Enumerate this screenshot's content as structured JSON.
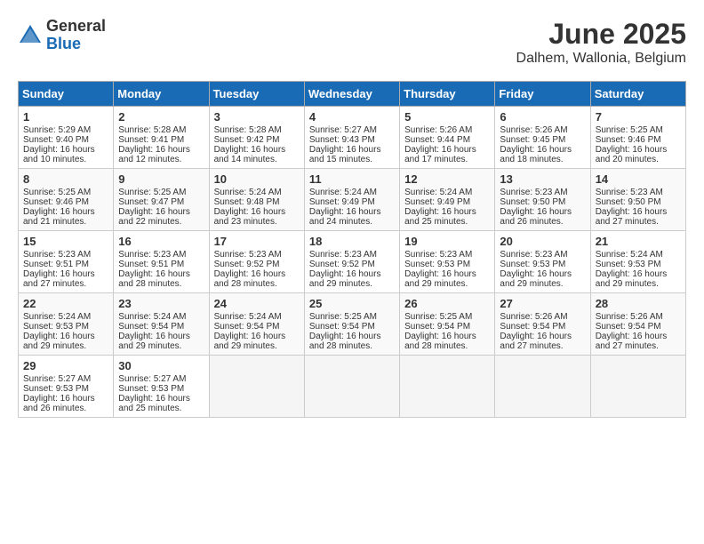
{
  "logo": {
    "general": "General",
    "blue": "Blue"
  },
  "title": "June 2025",
  "location": "Dalhem, Wallonia, Belgium",
  "headers": [
    "Sunday",
    "Monday",
    "Tuesday",
    "Wednesday",
    "Thursday",
    "Friday",
    "Saturday"
  ],
  "weeks": [
    [
      {
        "day": "1",
        "sunrise": "Sunrise: 5:29 AM",
        "sunset": "Sunset: 9:40 PM",
        "daylight": "Daylight: 16 hours and 10 minutes."
      },
      {
        "day": "2",
        "sunrise": "Sunrise: 5:28 AM",
        "sunset": "Sunset: 9:41 PM",
        "daylight": "Daylight: 16 hours and 12 minutes."
      },
      {
        "day": "3",
        "sunrise": "Sunrise: 5:28 AM",
        "sunset": "Sunset: 9:42 PM",
        "daylight": "Daylight: 16 hours and 14 minutes."
      },
      {
        "day": "4",
        "sunrise": "Sunrise: 5:27 AM",
        "sunset": "Sunset: 9:43 PM",
        "daylight": "Daylight: 16 hours and 15 minutes."
      },
      {
        "day": "5",
        "sunrise": "Sunrise: 5:26 AM",
        "sunset": "Sunset: 9:44 PM",
        "daylight": "Daylight: 16 hours and 17 minutes."
      },
      {
        "day": "6",
        "sunrise": "Sunrise: 5:26 AM",
        "sunset": "Sunset: 9:45 PM",
        "daylight": "Daylight: 16 hours and 18 minutes."
      },
      {
        "day": "7",
        "sunrise": "Sunrise: 5:25 AM",
        "sunset": "Sunset: 9:46 PM",
        "daylight": "Daylight: 16 hours and 20 minutes."
      }
    ],
    [
      {
        "day": "8",
        "sunrise": "Sunrise: 5:25 AM",
        "sunset": "Sunset: 9:46 PM",
        "daylight": "Daylight: 16 hours and 21 minutes."
      },
      {
        "day": "9",
        "sunrise": "Sunrise: 5:25 AM",
        "sunset": "Sunset: 9:47 PM",
        "daylight": "Daylight: 16 hours and 22 minutes."
      },
      {
        "day": "10",
        "sunrise": "Sunrise: 5:24 AM",
        "sunset": "Sunset: 9:48 PM",
        "daylight": "Daylight: 16 hours and 23 minutes."
      },
      {
        "day": "11",
        "sunrise": "Sunrise: 5:24 AM",
        "sunset": "Sunset: 9:49 PM",
        "daylight": "Daylight: 16 hours and 24 minutes."
      },
      {
        "day": "12",
        "sunrise": "Sunrise: 5:24 AM",
        "sunset": "Sunset: 9:49 PM",
        "daylight": "Daylight: 16 hours and 25 minutes."
      },
      {
        "day": "13",
        "sunrise": "Sunrise: 5:23 AM",
        "sunset": "Sunset: 9:50 PM",
        "daylight": "Daylight: 16 hours and 26 minutes."
      },
      {
        "day": "14",
        "sunrise": "Sunrise: 5:23 AM",
        "sunset": "Sunset: 9:50 PM",
        "daylight": "Daylight: 16 hours and 27 minutes."
      }
    ],
    [
      {
        "day": "15",
        "sunrise": "Sunrise: 5:23 AM",
        "sunset": "Sunset: 9:51 PM",
        "daylight": "Daylight: 16 hours and 27 minutes."
      },
      {
        "day": "16",
        "sunrise": "Sunrise: 5:23 AM",
        "sunset": "Sunset: 9:51 PM",
        "daylight": "Daylight: 16 hours and 28 minutes."
      },
      {
        "day": "17",
        "sunrise": "Sunrise: 5:23 AM",
        "sunset": "Sunset: 9:52 PM",
        "daylight": "Daylight: 16 hours and 28 minutes."
      },
      {
        "day": "18",
        "sunrise": "Sunrise: 5:23 AM",
        "sunset": "Sunset: 9:52 PM",
        "daylight": "Daylight: 16 hours and 29 minutes."
      },
      {
        "day": "19",
        "sunrise": "Sunrise: 5:23 AM",
        "sunset": "Sunset: 9:53 PM",
        "daylight": "Daylight: 16 hours and 29 minutes."
      },
      {
        "day": "20",
        "sunrise": "Sunrise: 5:23 AM",
        "sunset": "Sunset: 9:53 PM",
        "daylight": "Daylight: 16 hours and 29 minutes."
      },
      {
        "day": "21",
        "sunrise": "Sunrise: 5:24 AM",
        "sunset": "Sunset: 9:53 PM",
        "daylight": "Daylight: 16 hours and 29 minutes."
      }
    ],
    [
      {
        "day": "22",
        "sunrise": "Sunrise: 5:24 AM",
        "sunset": "Sunset: 9:53 PM",
        "daylight": "Daylight: 16 hours and 29 minutes."
      },
      {
        "day": "23",
        "sunrise": "Sunrise: 5:24 AM",
        "sunset": "Sunset: 9:54 PM",
        "daylight": "Daylight: 16 hours and 29 minutes."
      },
      {
        "day": "24",
        "sunrise": "Sunrise: 5:24 AM",
        "sunset": "Sunset: 9:54 PM",
        "daylight": "Daylight: 16 hours and 29 minutes."
      },
      {
        "day": "25",
        "sunrise": "Sunrise: 5:25 AM",
        "sunset": "Sunset: 9:54 PM",
        "daylight": "Daylight: 16 hours and 28 minutes."
      },
      {
        "day": "26",
        "sunrise": "Sunrise: 5:25 AM",
        "sunset": "Sunset: 9:54 PM",
        "daylight": "Daylight: 16 hours and 28 minutes."
      },
      {
        "day": "27",
        "sunrise": "Sunrise: 5:26 AM",
        "sunset": "Sunset: 9:54 PM",
        "daylight": "Daylight: 16 hours and 27 minutes."
      },
      {
        "day": "28",
        "sunrise": "Sunrise: 5:26 AM",
        "sunset": "Sunset: 9:54 PM",
        "daylight": "Daylight: 16 hours and 27 minutes."
      }
    ],
    [
      {
        "day": "29",
        "sunrise": "Sunrise: 5:27 AM",
        "sunset": "Sunset: 9:53 PM",
        "daylight": "Daylight: 16 hours and 26 minutes."
      },
      {
        "day": "30",
        "sunrise": "Sunrise: 5:27 AM",
        "sunset": "Sunset: 9:53 PM",
        "daylight": "Daylight: 16 hours and 25 minutes."
      },
      null,
      null,
      null,
      null,
      null
    ]
  ]
}
